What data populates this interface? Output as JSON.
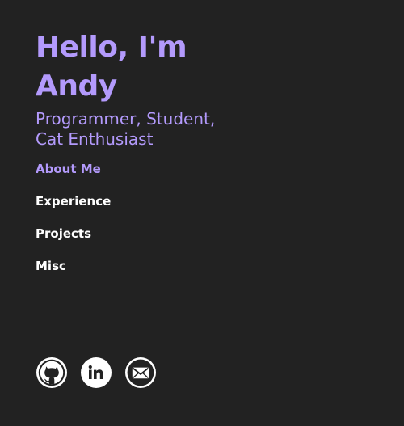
{
  "hero": {
    "title_line1": "Hello, I'm",
    "title_line2": "Andy",
    "subtitle_line1": "Programmer, Student,",
    "subtitle_line2": "Cat Enthusiast"
  },
  "nav": {
    "items": [
      {
        "label": "About Me",
        "active": true
      },
      {
        "label": "Experience",
        "active": false
      },
      {
        "label": "Projects",
        "active": false
      },
      {
        "label": "Misc",
        "active": false
      }
    ]
  },
  "social": {
    "icons": [
      "github-icon",
      "linkedin-icon",
      "mail-icon"
    ]
  },
  "colors": {
    "background": "#222222",
    "accent": "#b39afc",
    "text": "#ffffff"
  }
}
